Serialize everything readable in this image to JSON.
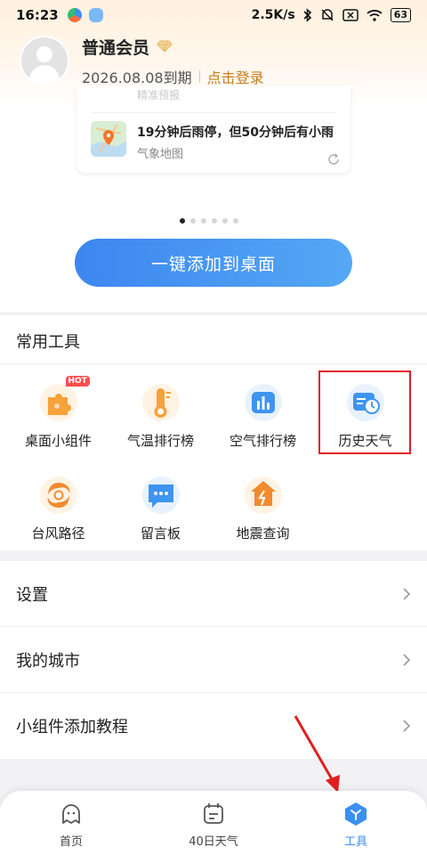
{
  "status_bar": {
    "time": "16:23",
    "network_speed": "2.5K/s",
    "battery": "63"
  },
  "profile": {
    "member_name": "普通会员",
    "expiry": "2026.08.08到期",
    "login_link": "点击登录"
  },
  "widget_preview": {
    "faded_text": "精准预报",
    "title": "19分钟后雨停，但50分钟后有小雨",
    "subtitle": "气象地图",
    "pager_total": 6,
    "pager_active": 0
  },
  "add_button": {
    "label": "一键添加到桌面"
  },
  "tools_section": {
    "title": "常用工具",
    "items": [
      {
        "label": "桌面小组件",
        "icon": "puzzle-icon",
        "badge": "HOT"
      },
      {
        "label": "气温排行榜",
        "icon": "thermometer-icon"
      },
      {
        "label": "空气排行榜",
        "icon": "air-chart-icon"
      },
      {
        "label": "历史天气",
        "icon": "history-clock-icon"
      },
      {
        "label": "台风路径",
        "icon": "typhoon-icon"
      },
      {
        "label": "留言板",
        "icon": "message-board-icon"
      },
      {
        "label": "地震查询",
        "icon": "earthquake-icon"
      }
    ]
  },
  "menu": {
    "items": [
      {
        "label": "设置"
      },
      {
        "label": "我的城市"
      },
      {
        "label": "小组件添加教程"
      }
    ]
  },
  "tab_bar": {
    "tabs": [
      {
        "label": "首页",
        "icon": "home-ghost-icon"
      },
      {
        "label": "40日天气",
        "icon": "calendar-icon"
      },
      {
        "label": "工具",
        "icon": "tools-icon",
        "active": true
      }
    ]
  },
  "colors": {
    "accent_blue": "#3a8ff2",
    "login_gold": "#c77e1e",
    "highlight_red": "#e02020",
    "hot_badge": "#ff4d4f"
  }
}
